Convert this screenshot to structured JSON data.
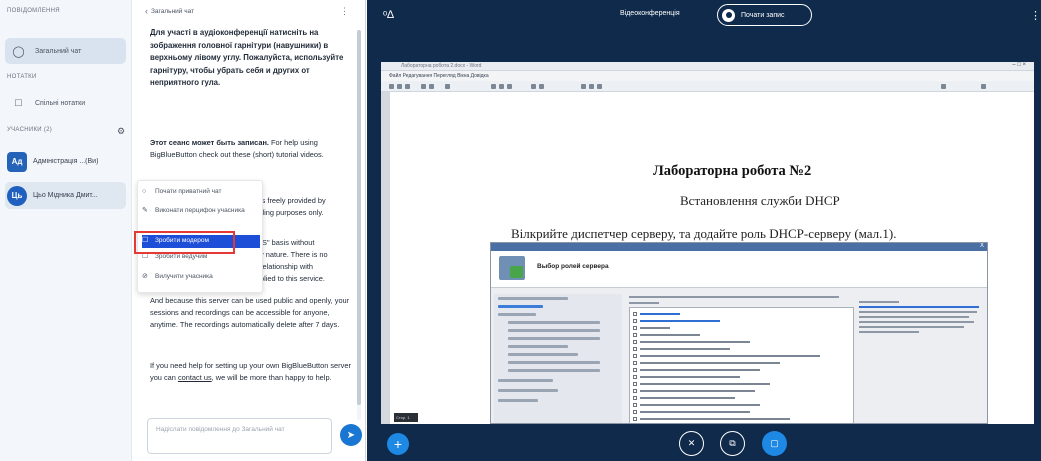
{
  "userlist": {
    "messages_label": "ПОВІДОМЛЕННЯ",
    "public_chat_label": "Загальний чат",
    "notes_label": "НОТАТКИ",
    "shared_notes_label": "Спільні нотатки",
    "users_label": "УЧАСНИКИ (2)",
    "users": [
      {
        "initials": "Ад",
        "name": "Адміністрація ...(Ви)"
      },
      {
        "initials": "Ць",
        "name": "Цьо Мідника Дмит..."
      }
    ]
  },
  "chat": {
    "header_back": "‹",
    "title": "Загальний чат",
    "more": "⋮",
    "welcome_bold": "Для участі в аудіоконференції натисніть на зображення головної гарнітури (навушники) в верхньому лівому углу. Пожалуйста, используйте гарнітуру, чтобы убрать себя и других от неприятного гула.",
    "record_bold": "Этот сеанс может быть записан.",
    "record_text": "For help using BigBlueButton check out these (short) tutorial videos.",
    "fragment1": "is freely provided by",
    "fragment2": "ding purposes only.",
    "fragment3": "IS\" basis without",
    "fragment4": "y nature. There is no",
    "fragment5": "relationship with",
    "fragment6": "plied to this service.",
    "public_text": "And because this server can be used public and openly, your sessions and recordings can be accessible for anyone, anytime. The recordings automatically delete after 7 days.",
    "help_text_before": "If you need help for setting up your own BigBlueButton server you can ",
    "help_link": "contact us",
    "help_text_after": ", we will be more than happy to help.",
    "input_placeholder": "Надіслати повідомлення до Загальний чат",
    "send_icon": "➤"
  },
  "context_menu": {
    "items": [
      {
        "icon": "○",
        "label": "Почати приватний чат"
      },
      {
        "icon": "✎",
        "label": "Виконати перцифон учасника"
      },
      {
        "icon": "☐",
        "label": "Зробити модером",
        "highlighted": true
      },
      {
        "icon": "☐",
        "label": "Зробити ведучим"
      },
      {
        "icon": "⊘",
        "label": "Вилучити учасника"
      }
    ]
  },
  "topbar": {
    "title": "Відеоконференція",
    "record_label": "Почати запис",
    "left_icon": "ᵒ∆",
    "right_icon": "⋮"
  },
  "slide": {
    "window_title": "Лабораторна робота 2.docx - Word",
    "window_controls": "–  □  ×",
    "menu": "Файл   Редагування   Перегляд   Вікна   Довідка",
    "title": "Лабораторна робота №2",
    "subtitle": "Встановлення служби DHCP",
    "instruction": "Вілкрийте диспетчер серверу, та додайте роль DHCP-серверу (мал.1).",
    "dialog_close": "X",
    "dialog_header": "Выбор ролей сервера",
    "page_tag": "Стор. 1"
  },
  "controls": {
    "plus": "+",
    "mic_icon": "✕",
    "camera_icon": "⧉",
    "screen_icon": "▢"
  }
}
